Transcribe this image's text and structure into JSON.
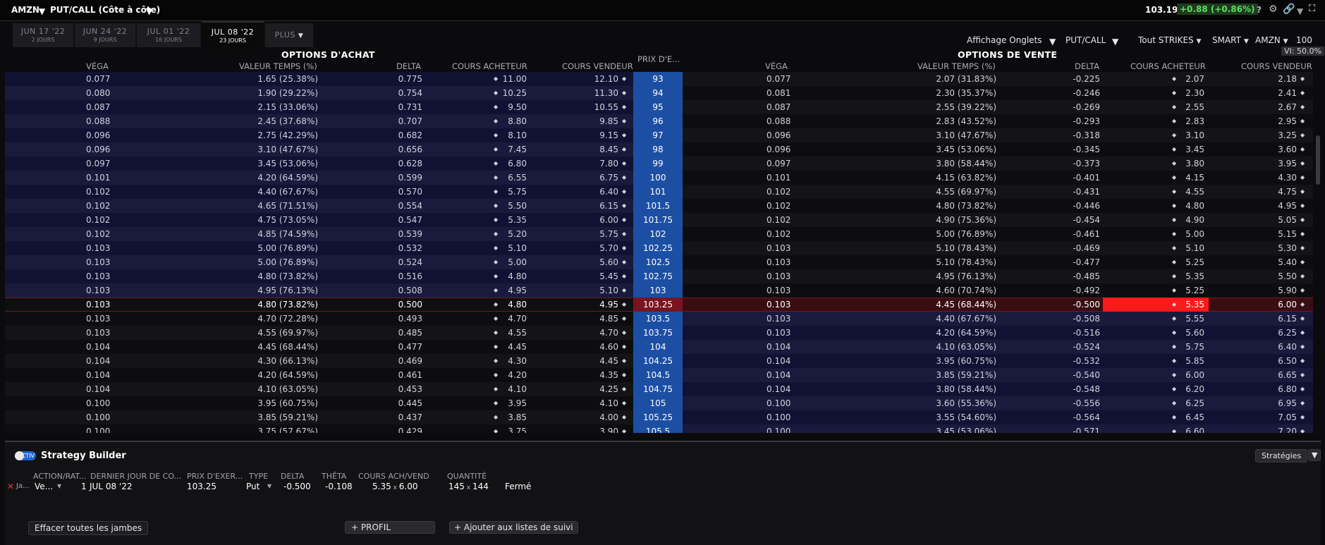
{
  "app": {
    "symbol": "AMZN",
    "view_label": "PUT/CALL (Côte à côte)",
    "last_price": "103.19",
    "change": "+0.88",
    "change_pct": "(+0.86%)"
  },
  "tabs": [
    {
      "label": "JUN 17 '22",
      "days": "2 JOURS"
    },
    {
      "label": "JUN 24 '22",
      "days": "9 JOURS"
    },
    {
      "label": "JUL 01 '22",
      "days": "16 JOURS"
    },
    {
      "label": "JUL 08 '22",
      "days": "23 JOURS"
    },
    {
      "label": "PLUS"
    }
  ],
  "controls": {
    "display": "Affichage Onglets",
    "putcall": "PUT/CALL",
    "strikes": "Tout STRIKES",
    "exchange": "SMART",
    "underlying": "AMZN",
    "multiplier": "100",
    "vi": "VI: 50.0%"
  },
  "headers": {
    "calls_title": "OPTIONS D'ACHAT",
    "puts_title": "OPTIONS DE VENTE",
    "vega": "VÉGA",
    "time_value": "VALEUR TEMPS (%)",
    "delta": "DELTA",
    "bid": "COURS ACHETEUR",
    "ask": "COURS VENDEUR",
    "strike": "PRIX D'E..."
  },
  "chain": [
    {
      "strike": "93",
      "c_vega": "0.077",
      "c_tv": "1.65 (25.38%)",
      "c_delta": "0.775",
      "c_bid": "11.00",
      "c_ask": "12.10",
      "p_vega": "0.077",
      "p_tv": "2.07 (31.83%)",
      "p_delta": "-0.225",
      "p_bid": "2.07",
      "p_ask": "2.18"
    },
    {
      "strike": "94",
      "c_vega": "0.080",
      "c_tv": "1.90 (29.22%)",
      "c_delta": "0.754",
      "c_bid": "10.25",
      "c_ask": "11.30",
      "p_vega": "0.081",
      "p_tv": "2.30 (35.37%)",
      "p_delta": "-0.246",
      "p_bid": "2.30",
      "p_ask": "2.41"
    },
    {
      "strike": "95",
      "c_vega": "0.087",
      "c_tv": "2.15 (33.06%)",
      "c_delta": "0.731",
      "c_bid": "9.50",
      "c_ask": "10.55",
      "p_vega": "0.087",
      "p_tv": "2.55 (39.22%)",
      "p_delta": "-0.269",
      "p_bid": "2.55",
      "p_ask": "2.67"
    },
    {
      "strike": "96",
      "c_vega": "0.088",
      "c_tv": "2.45 (37.68%)",
      "c_delta": "0.707",
      "c_bid": "8.80",
      "c_ask": "9.85",
      "p_vega": "0.088",
      "p_tv": "2.83 (43.52%)",
      "p_delta": "-0.293",
      "p_bid": "2.83",
      "p_ask": "2.95"
    },
    {
      "strike": "97",
      "c_vega": "0.096",
      "c_tv": "2.75 (42.29%)",
      "c_delta": "0.682",
      "c_bid": "8.10",
      "c_ask": "9.15",
      "p_vega": "0.096",
      "p_tv": "3.10 (47.67%)",
      "p_delta": "-0.318",
      "p_bid": "3.10",
      "p_ask": "3.25"
    },
    {
      "strike": "98",
      "c_vega": "0.096",
      "c_tv": "3.10 (47.67%)",
      "c_delta": "0.656",
      "c_bid": "7.45",
      "c_ask": "8.45",
      "p_vega": "0.096",
      "p_tv": "3.45 (53.06%)",
      "p_delta": "-0.345",
      "p_bid": "3.45",
      "p_ask": "3.60"
    },
    {
      "strike": "99",
      "c_vega": "0.097",
      "c_tv": "3.45 (53.06%)",
      "c_delta": "0.628",
      "c_bid": "6.80",
      "c_ask": "7.80",
      "p_vega": "0.097",
      "p_tv": "3.80 (58.44%)",
      "p_delta": "-0.373",
      "p_bid": "3.80",
      "p_ask": "3.95"
    },
    {
      "strike": "100",
      "c_vega": "0.101",
      "c_tv": "4.20 (64.59%)",
      "c_delta": "0.599",
      "c_bid": "6.55",
      "c_ask": "6.75",
      "p_vega": "0.101",
      "p_tv": "4.15 (63.82%)",
      "p_delta": "-0.401",
      "p_bid": "4.15",
      "p_ask": "4.30"
    },
    {
      "strike": "101",
      "c_vega": "0.102",
      "c_tv": "4.40 (67.67%)",
      "c_delta": "0.570",
      "c_bid": "5.75",
      "c_ask": "6.40",
      "p_vega": "0.102",
      "p_tv": "4.55 (69.97%)",
      "p_delta": "-0.431",
      "p_bid": "4.55",
      "p_ask": "4.75"
    },
    {
      "strike": "101.5",
      "c_vega": "0.102",
      "c_tv": "4.65 (71.51%)",
      "c_delta": "0.554",
      "c_bid": "5.50",
      "c_ask": "6.15",
      "p_vega": "0.102",
      "p_tv": "4.80 (73.82%)",
      "p_delta": "-0.446",
      "p_bid": "4.80",
      "p_ask": "4.95"
    },
    {
      "strike": "101.75",
      "c_vega": "0.102",
      "c_tv": "4.75 (73.05%)",
      "c_delta": "0.547",
      "c_bid": "5.35",
      "c_ask": "6.00",
      "p_vega": "0.102",
      "p_tv": "4.90 (75.36%)",
      "p_delta": "-0.454",
      "p_bid": "4.90",
      "p_ask": "5.05"
    },
    {
      "strike": "102",
      "c_vega": "0.102",
      "c_tv": "4.85 (74.59%)",
      "c_delta": "0.539",
      "c_bid": "5.20",
      "c_ask": "5.75",
      "p_vega": "0.102",
      "p_tv": "5.00 (76.89%)",
      "p_delta": "-0.461",
      "p_bid": "5.00",
      "p_ask": "5.15"
    },
    {
      "strike": "102.25",
      "c_vega": "0.103",
      "c_tv": "5.00 (76.89%)",
      "c_delta": "0.532",
      "c_bid": "5.10",
      "c_ask": "5.70",
      "p_vega": "0.103",
      "p_tv": "5.10 (78.43%)",
      "p_delta": "-0.469",
      "p_bid": "5.10",
      "p_ask": "5.30"
    },
    {
      "strike": "102.5",
      "c_vega": "0.103",
      "c_tv": "5.00 (76.89%)",
      "c_delta": "0.524",
      "c_bid": "5.00",
      "c_ask": "5.60",
      "p_vega": "0.103",
      "p_tv": "5.10 (78.43%)",
      "p_delta": "-0.477",
      "p_bid": "5.25",
      "p_ask": "5.40"
    },
    {
      "strike": "102.75",
      "c_vega": "0.103",
      "c_tv": "4.80 (73.82%)",
      "c_delta": "0.516",
      "c_bid": "4.80",
      "c_ask": "5.45",
      "p_vega": "0.103",
      "p_tv": "4.95 (76.13%)",
      "p_delta": "-0.485",
      "p_bid": "5.35",
      "p_ask": "5.50"
    },
    {
      "strike": "103",
      "c_vega": "0.103",
      "c_tv": "4.95 (76.13%)",
      "c_delta": "0.508",
      "c_bid": "4.95",
      "c_ask": "5.10",
      "p_vega": "0.103",
      "p_tv": "4.60 (70.74%)",
      "p_delta": "-0.492",
      "p_bid": "5.25",
      "p_ask": "5.90"
    },
    {
      "strike": "103.25",
      "c_vega": "0.103",
      "c_tv": "4.80 (73.82%)",
      "c_delta": "0.500",
      "c_bid": "4.80",
      "c_ask": "4.95",
      "p_vega": "0.103",
      "p_tv": "4.45 (68.44%)",
      "p_delta": "-0.500",
      "p_bid": "5.35",
      "p_ask": "6.00",
      "selected": true
    },
    {
      "strike": "103.5",
      "c_vega": "0.103",
      "c_tv": "4.70 (72.28%)",
      "c_delta": "0.493",
      "c_bid": "4.70",
      "c_ask": "4.85",
      "p_vega": "0.103",
      "p_tv": "4.40 (67.67%)",
      "p_delta": "-0.508",
      "p_bid": "5.55",
      "p_ask": "6.15"
    },
    {
      "strike": "103.75",
      "c_vega": "0.103",
      "c_tv": "4.55 (69.97%)",
      "c_delta": "0.485",
      "c_bid": "4.55",
      "c_ask": "4.70",
      "p_vega": "0.103",
      "p_tv": "4.20 (64.59%)",
      "p_delta": "-0.516",
      "p_bid": "5.60",
      "p_ask": "6.25"
    },
    {
      "strike": "104",
      "c_vega": "0.104",
      "c_tv": "4.45 (68.44%)",
      "c_delta": "0.477",
      "c_bid": "4.45",
      "c_ask": "4.60",
      "p_vega": "0.104",
      "p_tv": "4.10 (63.05%)",
      "p_delta": "-0.524",
      "p_bid": "5.75",
      "p_ask": "6.40"
    },
    {
      "strike": "104.25",
      "c_vega": "0.104",
      "c_tv": "4.30 (66.13%)",
      "c_delta": "0.469",
      "c_bid": "4.30",
      "c_ask": "4.45",
      "p_vega": "0.104",
      "p_tv": "3.95 (60.75%)",
      "p_delta": "-0.532",
      "p_bid": "5.85",
      "p_ask": "6.50"
    },
    {
      "strike": "104.5",
      "c_vega": "0.104",
      "c_tv": "4.20 (64.59%)",
      "c_delta": "0.461",
      "c_bid": "4.20",
      "c_ask": "4.35",
      "p_vega": "0.104",
      "p_tv": "3.85 (59.21%)",
      "p_delta": "-0.540",
      "p_bid": "6.00",
      "p_ask": "6.65"
    },
    {
      "strike": "104.75",
      "c_vega": "0.104",
      "c_tv": "4.10 (63.05%)",
      "c_delta": "0.453",
      "c_bid": "4.10",
      "c_ask": "4.25",
      "p_vega": "0.104",
      "p_tv": "3.80 (58.44%)",
      "p_delta": "-0.548",
      "p_bid": "6.20",
      "p_ask": "6.80"
    },
    {
      "strike": "105",
      "c_vega": "0.100",
      "c_tv": "3.95 (60.75%)",
      "c_delta": "0.445",
      "c_bid": "3.95",
      "c_ask": "4.10",
      "p_vega": "0.100",
      "p_tv": "3.60 (55.36%)",
      "p_delta": "-0.556",
      "p_bid": "6.25",
      "p_ask": "6.95"
    },
    {
      "strike": "105.25",
      "c_vega": "0.100",
      "c_tv": "3.85 (59.21%)",
      "c_delta": "0.437",
      "c_bid": "3.85",
      "c_ask": "4.00",
      "p_vega": "0.100",
      "p_tv": "3.55 (54.60%)",
      "p_delta": "-0.564",
      "p_bid": "6.45",
      "p_ask": "7.05"
    },
    {
      "strike": "105.5",
      "c_vega": "0.100",
      "c_tv": "3.75 (57.67%)",
      "c_delta": "0.429",
      "c_bid": "3.75",
      "c_ask": "3.90",
      "p_vega": "0.100",
      "p_tv": "3.45 (53.06%)",
      "p_delta": "-0.571",
      "p_bid": "6.60",
      "p_ask": "7.20"
    }
  ],
  "strategy": {
    "toggle_label": "ACTIV",
    "title": "Strategy Builder",
    "strategies_button": "Stratégies",
    "columns": {
      "action": "ACTION/RAT...",
      "last_day": "DERNIER JOUR DE CO...",
      "strike": "PRIX D'EXER...",
      "type": "TYPE",
      "delta": "DELTA",
      "theta": "THÊTA",
      "bidask": "COURS ACH/VEND",
      "qty": "QUANTITÉ"
    },
    "leg": {
      "prefix": "Ja...",
      "action": "Ve...",
      "ratio": "1",
      "last_day": "JUL 08 '22",
      "strike": "103.25",
      "type": "Put",
      "delta": "-0.500",
      "theta": "-0.108",
      "bid": "5.35",
      "ask": "6.00",
      "qty_bid": "145",
      "qty_ask": "144",
      "status": "Fermé"
    },
    "clear_button": "Effacer toutes les jambes",
    "profile_button": "PROFIL",
    "watchlist_button": "Ajouter aux listes de suivi"
  },
  "colors": {
    "strike_bg": "#1c4fa3",
    "selected_row": "#3a0d12",
    "selected_ask": "#ff1a1a",
    "positive": "#3fd34a"
  }
}
